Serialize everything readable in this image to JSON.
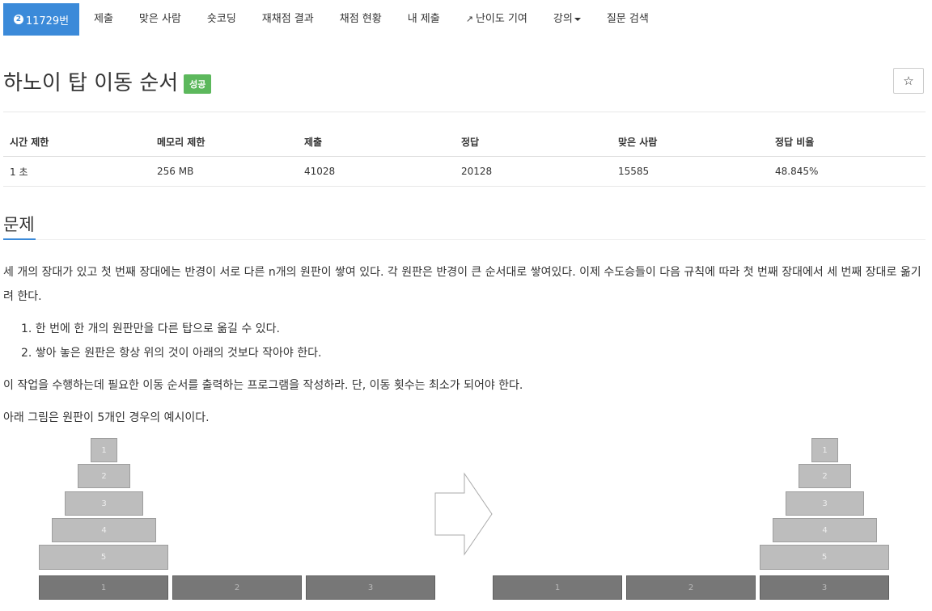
{
  "nav": {
    "problem_id": "11729번",
    "items": [
      "제출",
      "맞은 사람",
      "숏코딩",
      "재채점 결과",
      "채점 현황",
      "내 제출",
      "난이도 기여",
      "강의",
      "질문 검색"
    ]
  },
  "problem": {
    "title": "하노이 탑 이동 순서",
    "status": "성공",
    "star": "☆"
  },
  "stats": {
    "headers": [
      "시간 제한",
      "메모리 제한",
      "제출",
      "정답",
      "맞은 사람",
      "정답 비율"
    ],
    "values": [
      "1 초",
      "256 MB",
      "41028",
      "20128",
      "15585",
      "48.845%"
    ]
  },
  "section": {
    "title": "문제",
    "para1": "세 개의 장대가 있고 첫 번째 장대에는 반경이 서로 다른 n개의 원판이 쌓여 있다. 각 원판은 반경이 큰 순서대로 쌓여있다. 이제 수도승들이 다음 규칙에 따라 첫 번째 장대에서 세 번째 장대로 옮기려 한다.",
    "rules": [
      "1. 한 번에 한 개의 원판만을 다른 탑으로 옮길 수 있다.",
      "2. 쌓아 놓은 원판은 항상 위의 것이 아래의 것보다 작아야 한다."
    ],
    "para2": "이 작업을 수행하는데 필요한 이동 순서를 출력하는 프로그램을 작성하라. 단, 이동 횟수는 최소가 되어야 한다.",
    "para3": "아래 그림은 원판이 5개인 경우의 예시이다."
  },
  "figure": {
    "disks": [
      "1",
      "2",
      "3",
      "4",
      "5"
    ],
    "pegs": [
      "1",
      "2",
      "3"
    ]
  }
}
